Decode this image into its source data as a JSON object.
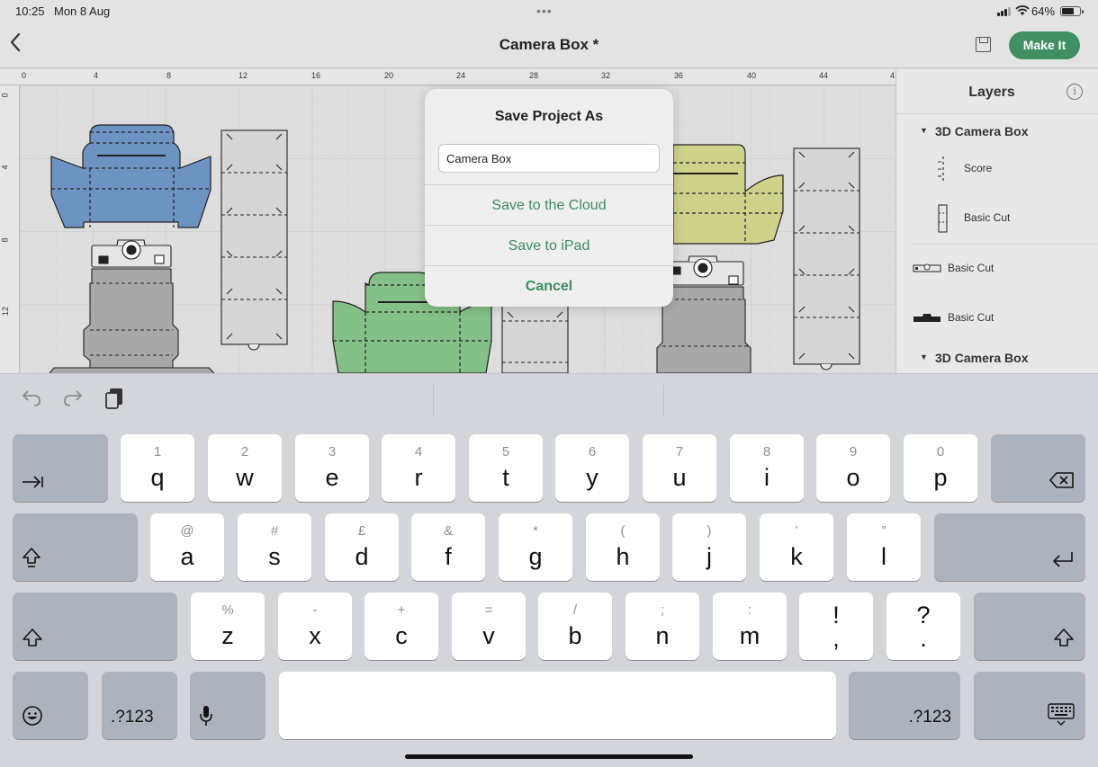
{
  "status": {
    "time": "10:25",
    "date": "Mon 8 Aug",
    "battery": "64%",
    "battery_level": 0.64,
    "wifi_icon": "wifi-icon",
    "signal_icon": "cellular-signal-icon"
  },
  "nav": {
    "title": "Camera Box *",
    "make_it_label": "Make It",
    "back_icon": "chevron-left-icon",
    "save_icon": "floppy-disk-icon",
    "accent_color": "#3f8f63"
  },
  "ruler": {
    "top_labels": [
      "0",
      "4",
      "8",
      "12",
      "16",
      "20",
      "24",
      "28",
      "32",
      "36",
      "40",
      "44",
      "4"
    ],
    "left_labels": [
      "0",
      "4",
      "8",
      "12"
    ]
  },
  "layers": {
    "title": "Layers",
    "groups": [
      {
        "label": "3D Camera Box"
      },
      {
        "label": "3D Camera Box"
      }
    ],
    "items": [
      {
        "label": "Score",
        "icon": "score-line-icon"
      },
      {
        "label": "Basic Cut",
        "icon": "basic-cut-strip-icon"
      },
      {
        "label": "Basic Cut",
        "icon": "camera-outline-icon"
      },
      {
        "label": "Basic Cut",
        "icon": "camera-silhouette-icon"
      }
    ]
  },
  "dialog": {
    "title": "Save Project As",
    "input_value": "Camera Box",
    "save_cloud": "Save to the Cloud",
    "save_ipad": "Save to iPad",
    "cancel": "Cancel"
  },
  "keyboard": {
    "row1": [
      {
        "sub": "1",
        "main": "q"
      },
      {
        "sub": "2",
        "main": "w"
      },
      {
        "sub": "3",
        "main": "e"
      },
      {
        "sub": "4",
        "main": "r"
      },
      {
        "sub": "5",
        "main": "t"
      },
      {
        "sub": "6",
        "main": "y"
      },
      {
        "sub": "7",
        "main": "u"
      },
      {
        "sub": "8",
        "main": "i"
      },
      {
        "sub": "9",
        "main": "o"
      },
      {
        "sub": "0",
        "main": "p"
      }
    ],
    "row2": [
      {
        "sub": "@",
        "main": "a"
      },
      {
        "sub": "#",
        "main": "s"
      },
      {
        "sub": "£",
        "main": "d"
      },
      {
        "sub": "&",
        "main": "f"
      },
      {
        "sub": "*",
        "main": "g"
      },
      {
        "sub": "(",
        "main": "h"
      },
      {
        "sub": ")",
        "main": "j"
      },
      {
        "sub": "’",
        "main": "k"
      },
      {
        "sub": "”",
        "main": "l"
      }
    ],
    "row3": [
      {
        "sub": "%",
        "main": "z"
      },
      {
        "sub": "-",
        "main": "x"
      },
      {
        "sub": "+",
        "main": "c"
      },
      {
        "sub": "=",
        "main": "v"
      },
      {
        "sub": "/",
        "main": "b"
      },
      {
        "sub": ";",
        "main": "n"
      },
      {
        "sub": ":",
        "main": "m"
      },
      {
        "sub": "!",
        "main": ","
      },
      {
        "sub": "?",
        "main": "."
      }
    ],
    "numbers_label": ".?123",
    "tab_icon": "tab-icon",
    "backspace_icon": "backspace-icon",
    "shift_icon": "shift-icon",
    "return_icon": "return-icon",
    "emoji_icon": "emoji-icon",
    "mic_icon": "microphone-icon",
    "dismiss_icon": "keyboard-dismiss-icon",
    "undo_icon": "undo-icon",
    "redo_icon": "redo-icon",
    "paste_icon": "paste-icon"
  }
}
